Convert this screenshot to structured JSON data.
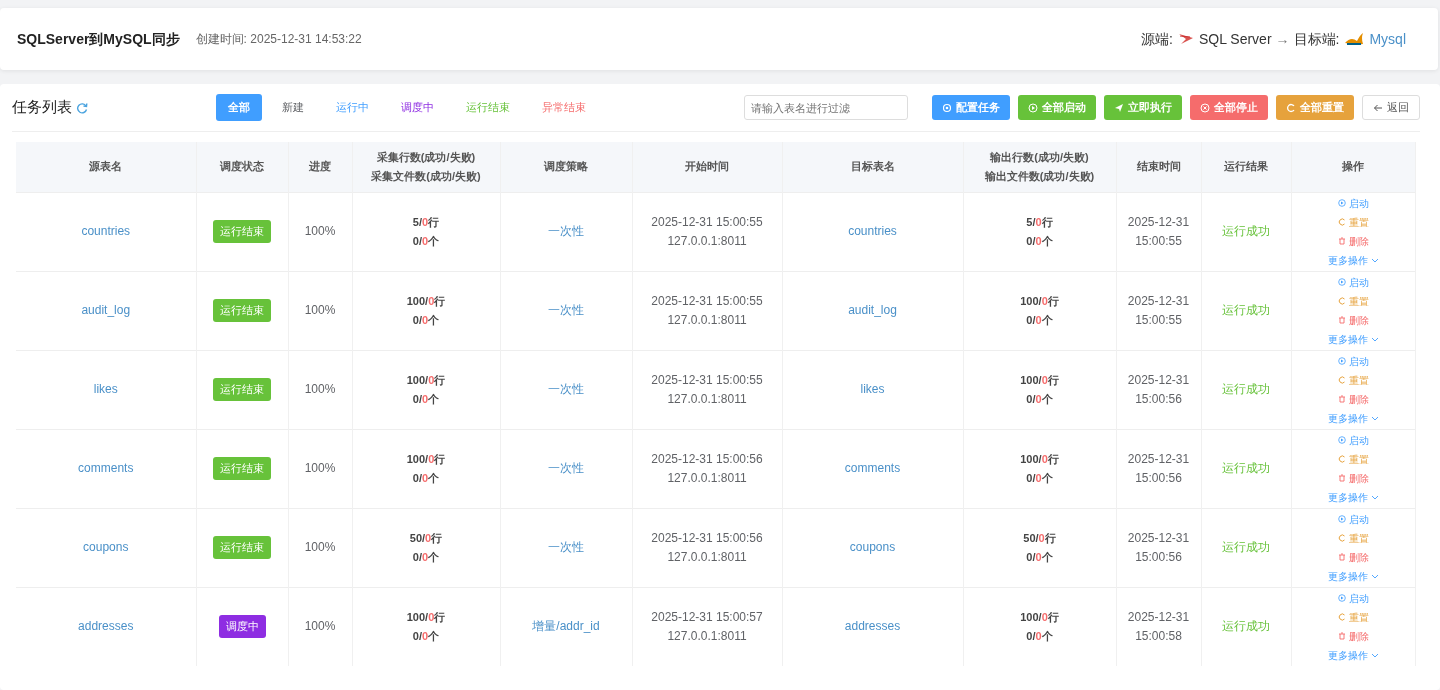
{
  "header": {
    "title": "SQLServer到MySQL同步",
    "created": "创建时间: 2025-12-31 14:53:22",
    "source_label": "源端:",
    "source_name": "SQL Server",
    "arrow": "→",
    "target_label": "目标端:",
    "target_name": "Mysql"
  },
  "toolbar": {
    "title": "任务列表",
    "filters": [
      {
        "label": "全部",
        "selected": true,
        "kind": "all"
      },
      {
        "label": "新建",
        "selected": false,
        "kind": "new"
      },
      {
        "label": "运行中",
        "selected": false,
        "kind": "running"
      },
      {
        "label": "调度中",
        "selected": false,
        "kind": "scheduling"
      },
      {
        "label": "运行结束",
        "selected": false,
        "kind": "finished"
      },
      {
        "label": "异常结束",
        "selected": false,
        "kind": "failed"
      }
    ],
    "search": {
      "placeholder": "请输入表名进行过滤"
    },
    "buttons": [
      {
        "label": "配置任务",
        "kind": "gear",
        "color": "#409eff"
      },
      {
        "label": "全部启动",
        "kind": "play",
        "color": "#67c23a"
      },
      {
        "label": "立即执行",
        "kind": "send",
        "color": "#67c23a"
      },
      {
        "label": "全部停止",
        "kind": "stop",
        "color": "#f56c6c"
      },
      {
        "label": "全部重置",
        "kind": "reset",
        "color": "#e6a23c"
      },
      {
        "label": "返回",
        "kind": "back",
        "color": "#ffffff"
      }
    ]
  },
  "table": {
    "columns": [
      "源表名",
      "调度状态",
      "进度",
      "采集行数(成功/失败)\n采集文件数(成功/失败)",
      "调度策略",
      "开始时间",
      "目标表名",
      "输出行数(成功/失败)\n输出文件数(成功/失败)",
      "结束时间",
      "运行结果",
      "操作"
    ],
    "rows": [
      {
        "source": "countries",
        "status": {
          "label": "运行结束",
          "kind": "finished"
        },
        "progress": "100%",
        "in_rows": [
          "5/",
          "0",
          "行"
        ],
        "in_files": [
          "0/",
          "0",
          "个"
        ],
        "strategy": "一次性",
        "start": "2025-12-31 15:00:55",
        "host": "127.0.0.1:8011",
        "target": "countries",
        "out_rows": [
          "5/",
          "0",
          "行"
        ],
        "out_files": [
          "0/",
          "0",
          "个"
        ],
        "end_date": "2025-12-31",
        "end_time": "15:00:55",
        "result": "运行成功",
        "actions": [
          "启动",
          "重置",
          "删除",
          "更多操作"
        ]
      },
      {
        "source": "audit_log",
        "status": {
          "label": "运行结束",
          "kind": "finished"
        },
        "progress": "100%",
        "in_rows": [
          "100/",
          "0",
          "行"
        ],
        "in_files": [
          "0/",
          "0",
          "个"
        ],
        "strategy": "一次性",
        "start": "2025-12-31 15:00:55",
        "host": "127.0.0.1:8011",
        "target": "audit_log",
        "out_rows": [
          "100/",
          "0",
          "行"
        ],
        "out_files": [
          "0/",
          "0",
          "个"
        ],
        "end_date": "2025-12-31",
        "end_time": "15:00:55",
        "result": "运行成功",
        "actions": [
          "启动",
          "重置",
          "删除",
          "更多操作"
        ]
      },
      {
        "source": "likes",
        "status": {
          "label": "运行结束",
          "kind": "finished"
        },
        "progress": "100%",
        "in_rows": [
          "100/",
          "0",
          "行"
        ],
        "in_files": [
          "0/",
          "0",
          "个"
        ],
        "strategy": "一次性",
        "start": "2025-12-31 15:00:55",
        "host": "127.0.0.1:8011",
        "target": "likes",
        "out_rows": [
          "100/",
          "0",
          "行"
        ],
        "out_files": [
          "0/",
          "0",
          "个"
        ],
        "end_date": "2025-12-31",
        "end_time": "15:00:56",
        "result": "运行成功",
        "actions": [
          "启动",
          "重置",
          "删除",
          "更多操作"
        ]
      },
      {
        "source": "comments",
        "status": {
          "label": "运行结束",
          "kind": "finished"
        },
        "progress": "100%",
        "in_rows": [
          "100/",
          "0",
          "行"
        ],
        "in_files": [
          "0/",
          "0",
          "个"
        ],
        "strategy": "一次性",
        "start": "2025-12-31 15:00:56",
        "host": "127.0.0.1:8011",
        "target": "comments",
        "out_rows": [
          "100/",
          "0",
          "行"
        ],
        "out_files": [
          "0/",
          "0",
          "个"
        ],
        "end_date": "2025-12-31",
        "end_time": "15:00:56",
        "result": "运行成功",
        "actions": [
          "启动",
          "重置",
          "删除",
          "更多操作"
        ]
      },
      {
        "source": "coupons",
        "status": {
          "label": "运行结束",
          "kind": "finished"
        },
        "progress": "100%",
        "in_rows": [
          "50/",
          "0",
          "行"
        ],
        "in_files": [
          "0/",
          "0",
          "个"
        ],
        "strategy": "一次性",
        "start": "2025-12-31 15:00:56",
        "host": "127.0.0.1:8011",
        "target": "coupons",
        "out_rows": [
          "50/",
          "0",
          "行"
        ],
        "out_files": [
          "0/",
          "0",
          "个"
        ],
        "end_date": "2025-12-31",
        "end_time": "15:00:56",
        "result": "运行成功",
        "actions": [
          "启动",
          "重置",
          "删除",
          "更多操作"
        ]
      },
      {
        "source": "addresses",
        "status": {
          "label": "调度中",
          "kind": "scheduling"
        },
        "progress": "100%",
        "in_rows": [
          "100/",
          "0",
          "行"
        ],
        "in_files": [
          "0/",
          "0",
          "个"
        ],
        "strategy": "增量/addr_id",
        "start": "2025-12-31 15:00:57",
        "host": "127.0.0.1:8011",
        "target": "addresses",
        "out_rows": [
          "100/",
          "0",
          "行"
        ],
        "out_files": [
          "0/",
          "0",
          "个"
        ],
        "end_date": "2025-12-31",
        "end_time": "15:00:58",
        "result": "运行成功",
        "actions": [
          "启动",
          "重置",
          "删除",
          "更多操作"
        ]
      }
    ]
  }
}
